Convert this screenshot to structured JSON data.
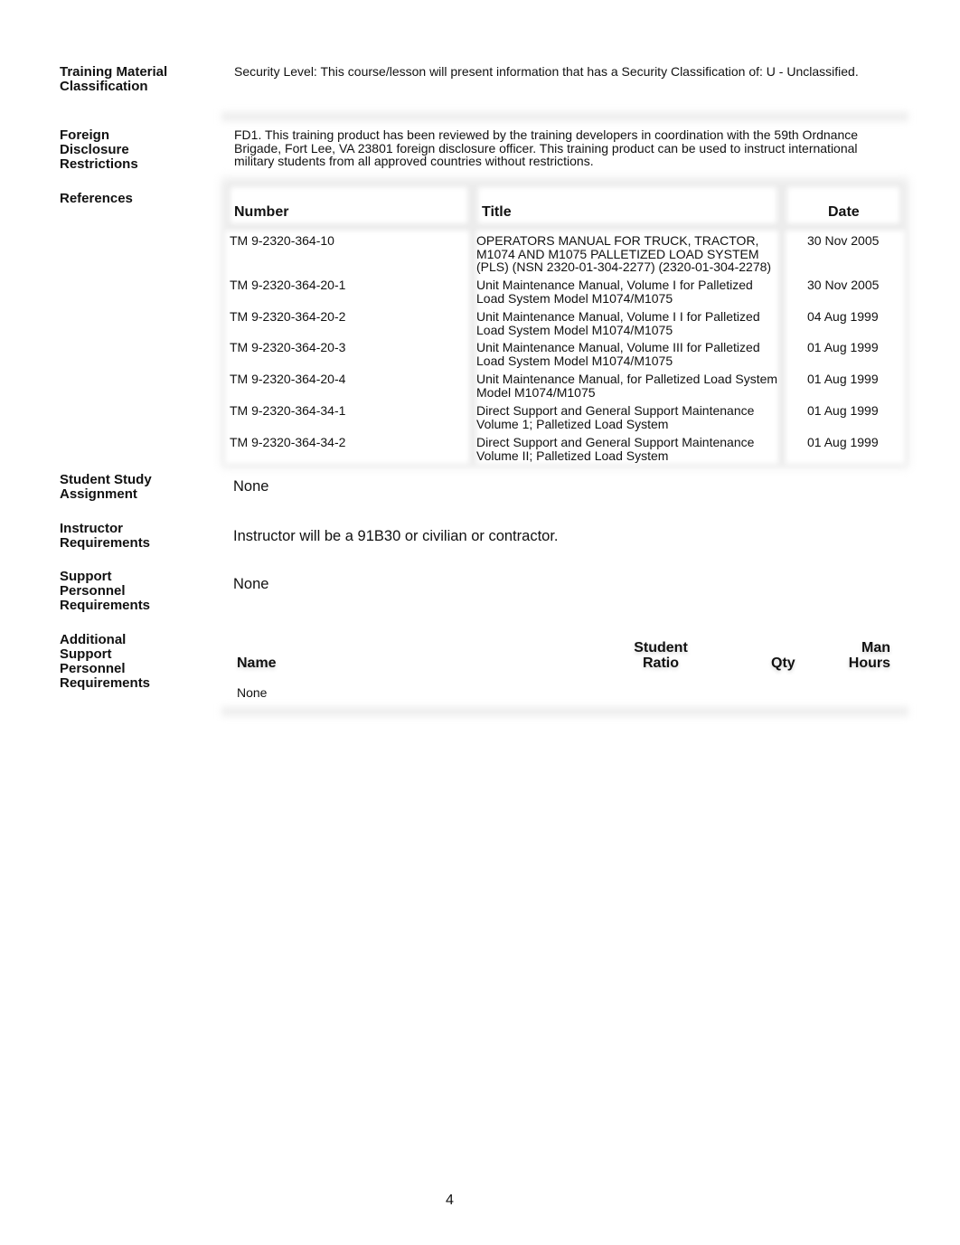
{
  "sections": {
    "training_material_classification": {
      "label": "Training Material Classification",
      "text": "Security Level: This course/lesson will present information that has a Security Classification of: U - Unclassified."
    },
    "foreign_disclosure": {
      "label": "Foreign Disclosure Restrictions",
      "text": "FD1. This training product has been reviewed by the training developers in coordination with the 59th Ordnance Brigade, Fort Lee, VA 23801 foreign disclosure officer.   This training product can be used to instruct international military students from all approved countries without restrictions."
    },
    "references": {
      "label": "References",
      "columns": [
        "Number",
        "Title",
        "Date"
      ],
      "rows": [
        {
          "number": "TM 9-2320-364-10",
          "title": "OPERATORS MANUAL FOR TRUCK, TRACTOR, M1074 AND M1075 PALLETIZED LOAD SYSTEM (PLS) (NSN 2320-01-304-2277) (2320-01-304-2278)",
          "date": "30 Nov 2005"
        },
        {
          "number": "TM 9-2320-364-20-1",
          "title": "Unit Maintenance Manual, Volume I for Palletized Load System Model M1074/M1075",
          "date": "30 Nov 2005"
        },
        {
          "number": "TM 9-2320-364-20-2",
          "title": "Unit Maintenance Manual, Volume I I for Palletized Load System Model M1074/M1075",
          "date": "04 Aug 1999"
        },
        {
          "number": "TM 9-2320-364-20-3",
          "title": "Unit Maintenance Manual, Volume III for Palletized Load System Model M1074/M1075",
          "date": "01 Aug 1999"
        },
        {
          "number": "TM 9-2320-364-20-4",
          "title": "Unit Maintenance Manual, for Palletized Load System Model M1074/M1075",
          "date": "01 Aug 1999"
        },
        {
          "number": "TM 9-2320-364-34-1",
          "title": "Direct Support and General Support Maintenance Volume 1; Palletized Load System",
          "date": "01 Aug 1999"
        },
        {
          "number": "TM 9-2320-364-34-2",
          "title": "Direct Support and General Support Maintenance Volume II; Palletized Load System",
          "date": "01 Aug 1999"
        }
      ]
    },
    "student_study": {
      "label": "Student Study Assignment",
      "text": "None"
    },
    "instructor": {
      "label": "Instructor Requirements",
      "text": "Instructor will be a 91B30 or civilian or contractor."
    },
    "support_personnel": {
      "label": "Support Personnel Requirements",
      "text": "None"
    },
    "additional_support": {
      "label": "Additional Support Personnel Requirements",
      "columns": {
        "name": "Name",
        "student_ratio": "Student Ratio",
        "qty": "Qty",
        "man_hours": "Man Hours"
      },
      "rows": [
        {
          "name": "None"
        }
      ]
    }
  },
  "page_number": "4"
}
